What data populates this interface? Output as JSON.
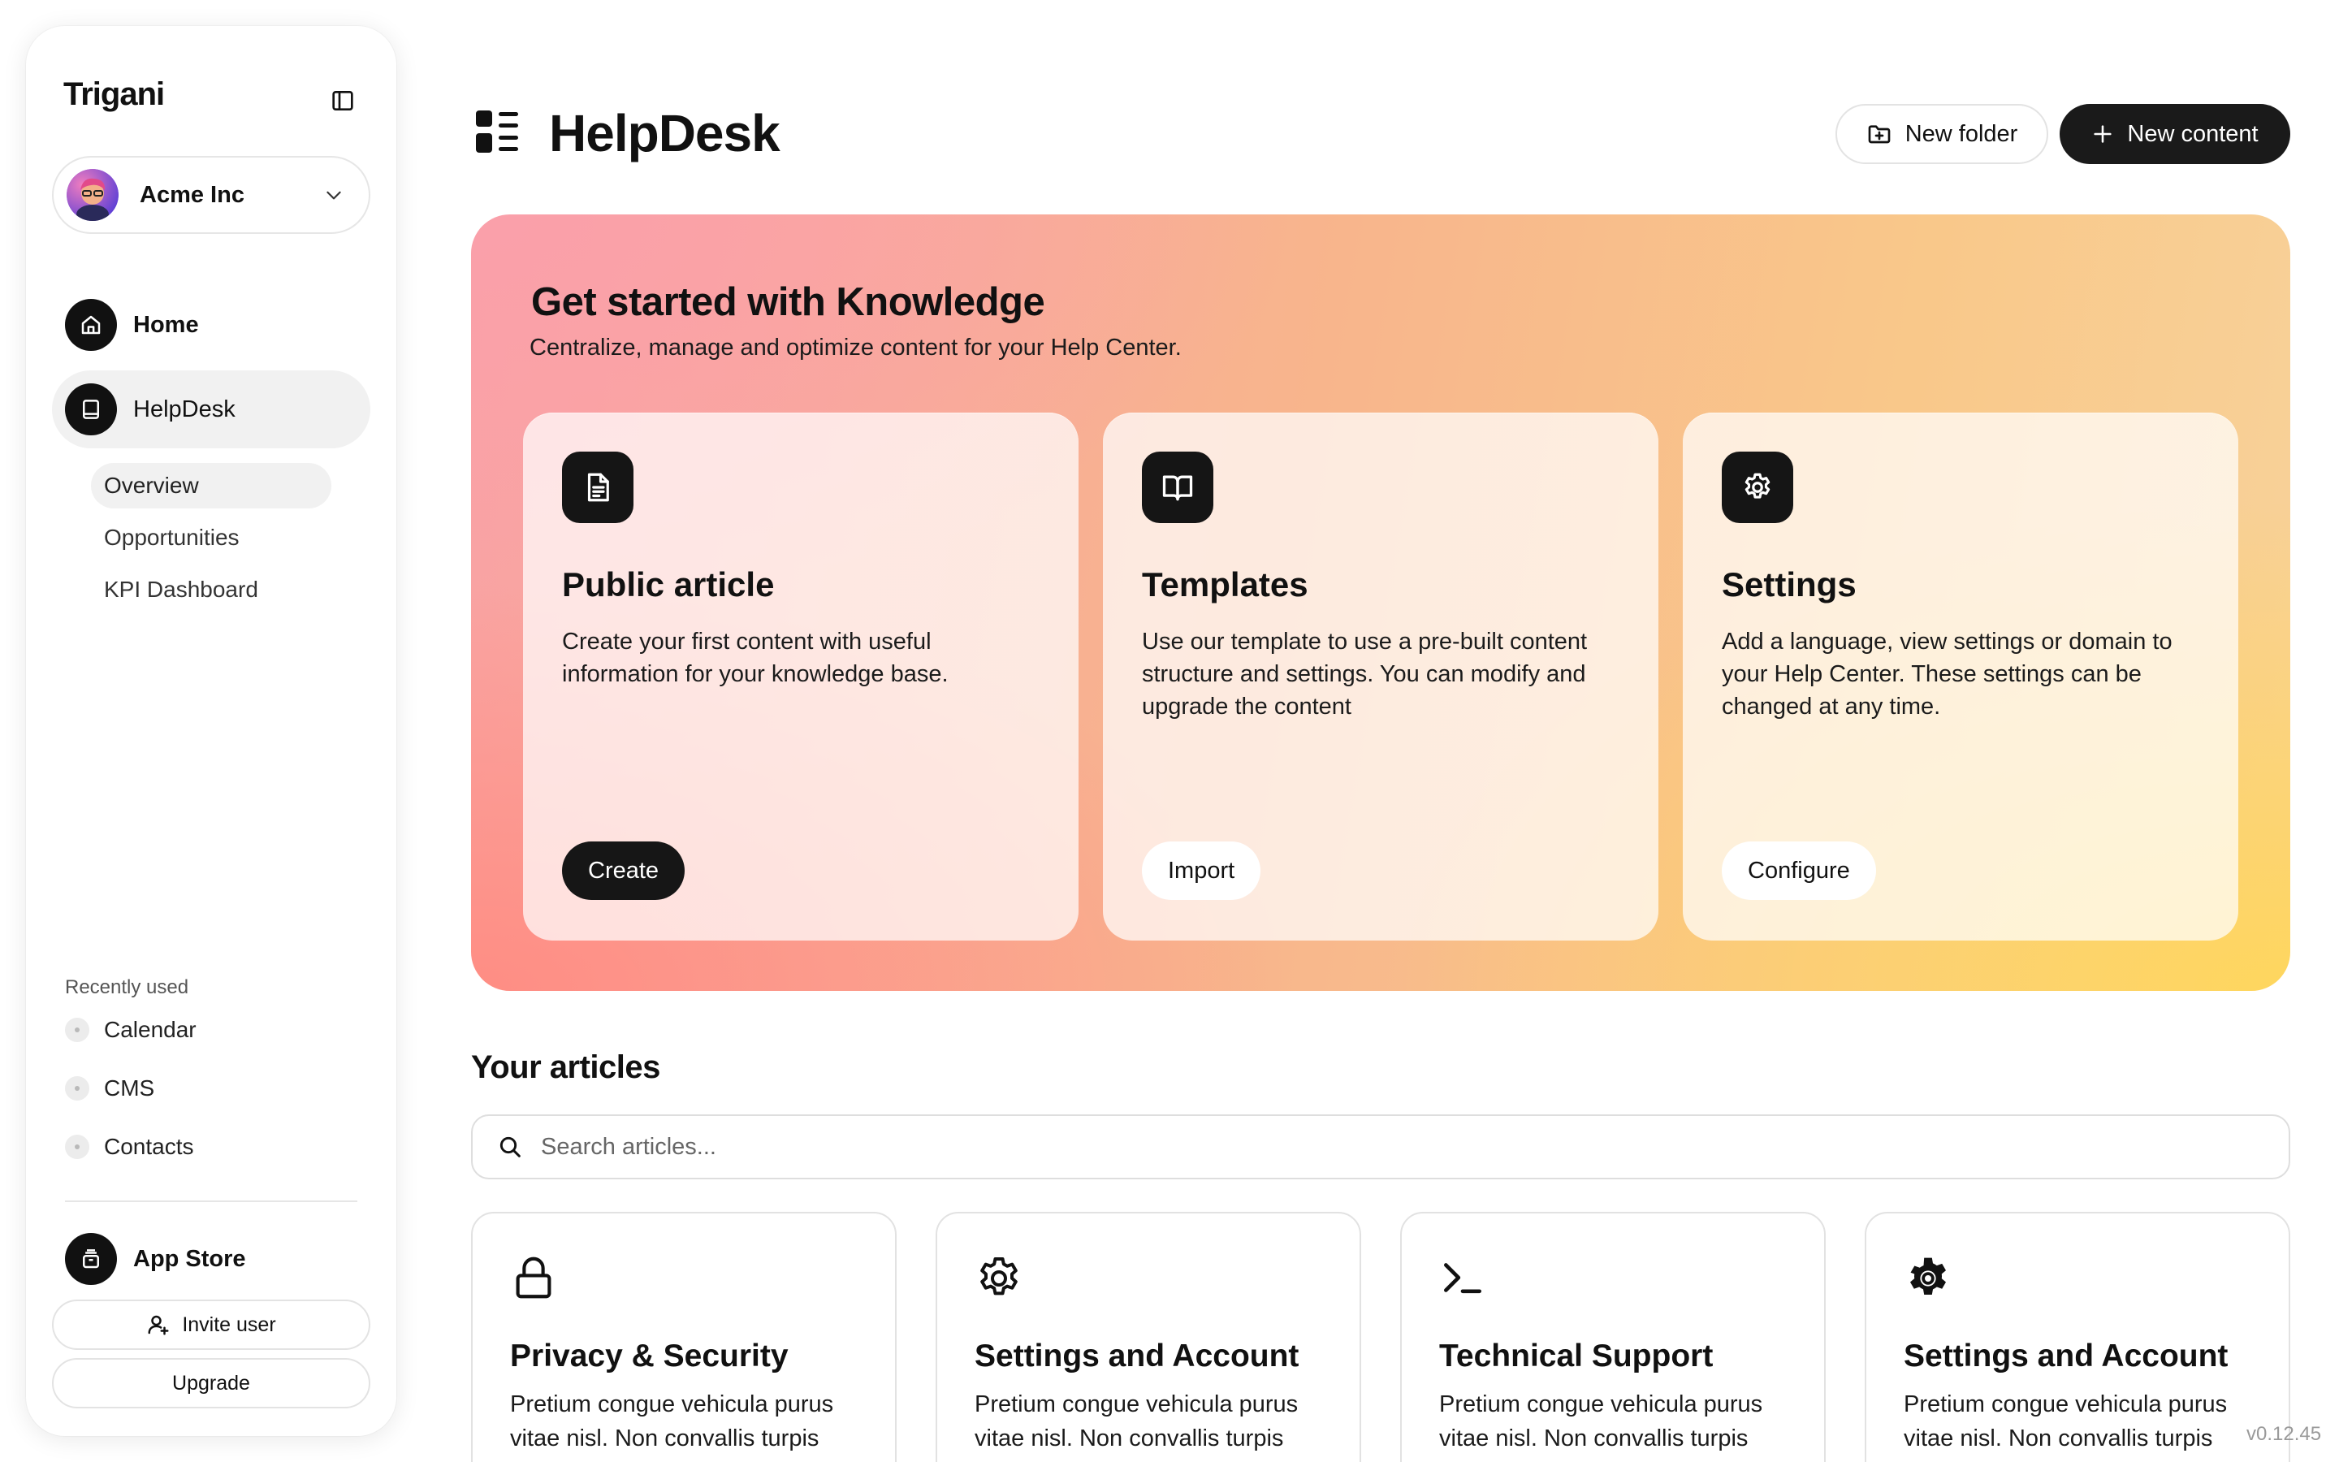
{
  "sidebar": {
    "brand": "Trigani",
    "org": {
      "name": "Acme Inc"
    },
    "nav": [
      {
        "label": "Home",
        "icon": "home-icon"
      },
      {
        "label": "HelpDesk",
        "icon": "book-icon",
        "active": true
      }
    ],
    "sub_nav": [
      {
        "label": "Overview",
        "active": true
      },
      {
        "label": "Opportunities"
      },
      {
        "label": "KPI Dashboard"
      }
    ],
    "recent_title": "Recently used",
    "recent": [
      {
        "label": "Calendar"
      },
      {
        "label": "CMS"
      },
      {
        "label": "Contacts"
      }
    ],
    "app_store": "App Store",
    "invite_label": "Invite user",
    "upgrade_label": "Upgrade"
  },
  "header": {
    "title": "HelpDesk",
    "new_folder_label": "New folder",
    "new_content_label": "New content"
  },
  "hero": {
    "title": "Get started with Knowledge",
    "subtitle": "Centralize, manage and optimize content for your Help Center.",
    "cards": [
      {
        "icon": "document-icon",
        "title": "Public article",
        "description": "Create your first content with useful information for your knowledge base.",
        "button": "Create"
      },
      {
        "icon": "open-book-icon",
        "title": "Templates",
        "description": "Use our template to use a pre-built content structure and settings. You can modify and upgrade the content",
        "button": "Import"
      },
      {
        "icon": "gear-icon",
        "title": "Settings",
        "description": "Add a language, view settings or domain to your Help Center. These settings can be changed at any time.",
        "button": "Configure"
      }
    ]
  },
  "articles": {
    "title": "Your articles",
    "search_placeholder": "Search articles...",
    "items": [
      {
        "icon": "lock-icon",
        "title": "Privacy & Security",
        "description": "Pretium congue vehicula purus vitae nisl. Non convallis turpis"
      },
      {
        "icon": "gear-icon",
        "title": "Settings and Account",
        "description": "Pretium congue vehicula purus vitae nisl. Non convallis turpis"
      },
      {
        "icon": "terminal-icon",
        "title": "Technical Support",
        "description": "Pretium congue vehicula purus vitae nisl. Non convallis turpis"
      },
      {
        "icon": "cog-icon",
        "title": "Settings and Account",
        "description": "Pretium congue vehicula purus vitae nisl. Non convallis turpis"
      }
    ]
  },
  "version": "v0.12.45",
  "colors": {
    "accent_dark": "#1a1a1a",
    "hero_pink": "#f9a2a4",
    "hero_yellow": "#ffd65a"
  }
}
